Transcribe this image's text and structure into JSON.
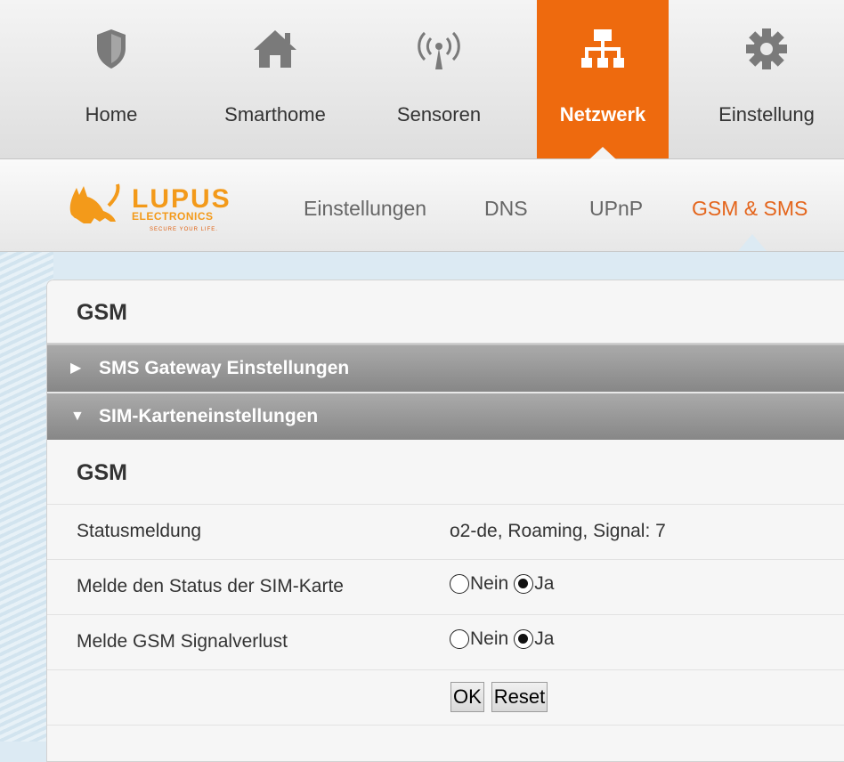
{
  "topnav": {
    "tabs": [
      {
        "label": "Home",
        "icon": "shield-icon"
      },
      {
        "label": "Smarthome",
        "icon": "house-icon"
      },
      {
        "label": "Sensoren",
        "icon": "antenna-icon"
      },
      {
        "label": "Netzwerk",
        "icon": "network-icon",
        "active": true
      },
      {
        "label": "Einstellung",
        "icon": "gear-icon"
      }
    ],
    "active_color": "#ee6a0e"
  },
  "logo": {
    "brand": "LUPUS",
    "sub": "ELECTRONICS",
    "tagline": "SECURE YOUR LIFE."
  },
  "subnav": {
    "tabs": [
      {
        "label": "Einstellungen"
      },
      {
        "label": "DNS"
      },
      {
        "label": "UPnP"
      },
      {
        "label": "GSM & SMS",
        "active": true
      }
    ],
    "active_color": "#e4651c"
  },
  "panel": {
    "title": "GSM",
    "accordions": [
      {
        "label": "SMS Gateway Einstellungen",
        "expanded": false
      },
      {
        "label": "SIM-Karteneinstellungen",
        "expanded": true
      }
    ],
    "section_title": "GSM",
    "rows": {
      "status": {
        "label": "Statusmeldung",
        "value": "o2-de, Roaming, Signal: 7"
      },
      "sim_status": {
        "label": "Melde den Status der SIM-Karte",
        "opt_no": "Nein",
        "opt_yes": "Ja",
        "selected": "Ja"
      },
      "signal_loss": {
        "label": "Melde GSM Signalverlust",
        "opt_no": "Nein",
        "opt_yes": "Ja",
        "selected": "Ja"
      }
    },
    "buttons": {
      "ok": "OK",
      "reset": "Reset"
    }
  }
}
